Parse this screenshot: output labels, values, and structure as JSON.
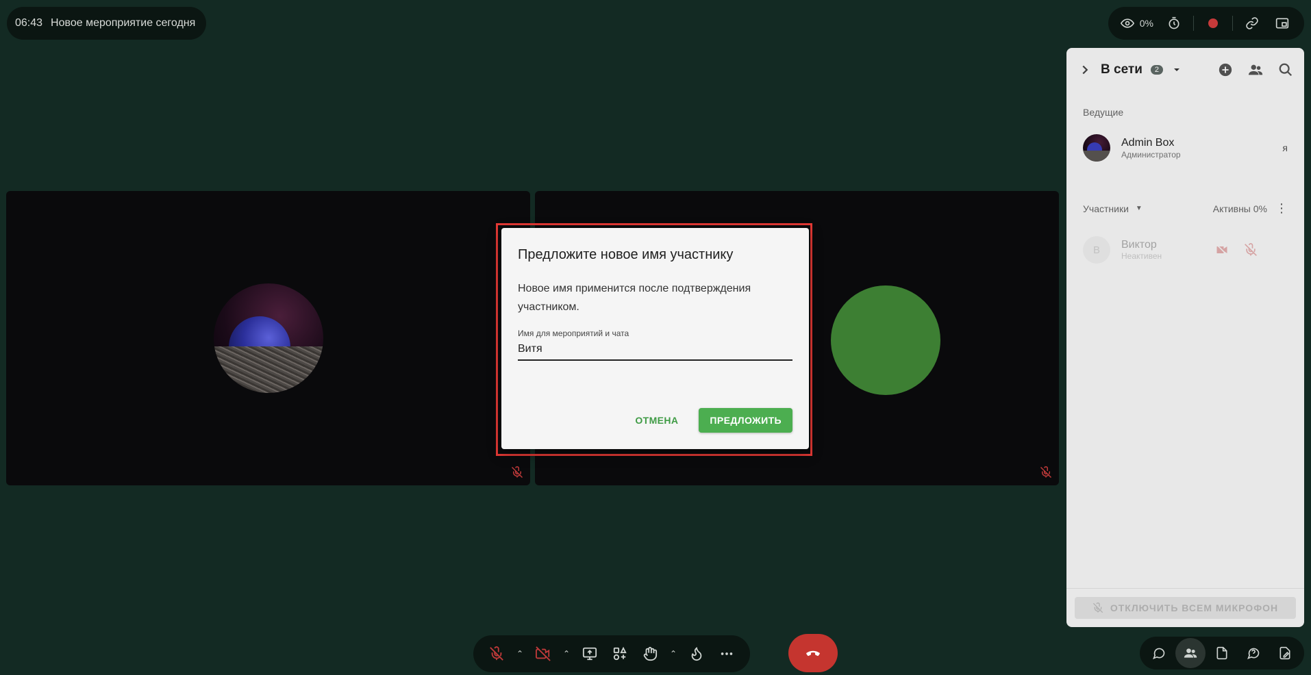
{
  "top_left": {
    "time": "06:43",
    "event_title": "Новое мероприятие сегодня"
  },
  "top_right": {
    "zoom": "0%"
  },
  "side_panel": {
    "title": "В сети",
    "online_count": "2",
    "hosts_section": "Ведущие",
    "host": {
      "name": "Admin Box",
      "role": "Администратор",
      "me": "я"
    },
    "participants_section": "Участники",
    "active_label": "Активны 0%",
    "participant": {
      "initial": "В",
      "name": "Виктор",
      "status": "Неактивен"
    },
    "mute_all": "ОТКЛЮЧИТЬ ВСЕМ МИКРОФОН"
  },
  "dialog": {
    "title": "Предложите новое имя участнику",
    "text": "Новое имя применится после подтверждения участником.",
    "field_label": "Имя для мероприятий и чата",
    "field_value": "Витя",
    "cancel": "ОТМЕНА",
    "submit": "ПРЕДЛОЖИТЬ"
  },
  "colors": {
    "background": "#132a23",
    "accent": "#4cae50",
    "danger": "#c5352f",
    "highlight": "#e53935"
  }
}
